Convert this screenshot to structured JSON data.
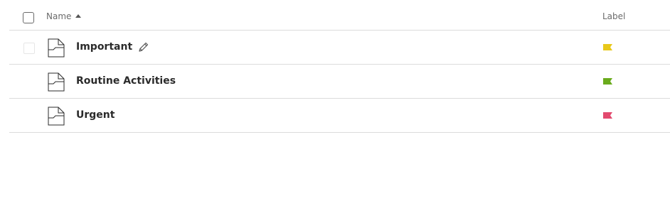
{
  "header": {
    "name_label": "Name",
    "label_label": "Label",
    "sort_icon": "sort-ascending-icon"
  },
  "rows": [
    {
      "name": "Important",
      "label_color": "#e8c81a",
      "show_edit": true,
      "icon": "document-icon"
    },
    {
      "name": "Routine Activities",
      "label_color": "#6aab1c",
      "show_edit": false,
      "icon": "document-icon"
    },
    {
      "name": "Urgent",
      "label_color": "#e24a6e",
      "show_edit": false,
      "icon": "document-icon"
    }
  ],
  "colors": {
    "border": "#dcdcdc",
    "text": "#2b2b2b",
    "muted": "#6b6b6b"
  }
}
